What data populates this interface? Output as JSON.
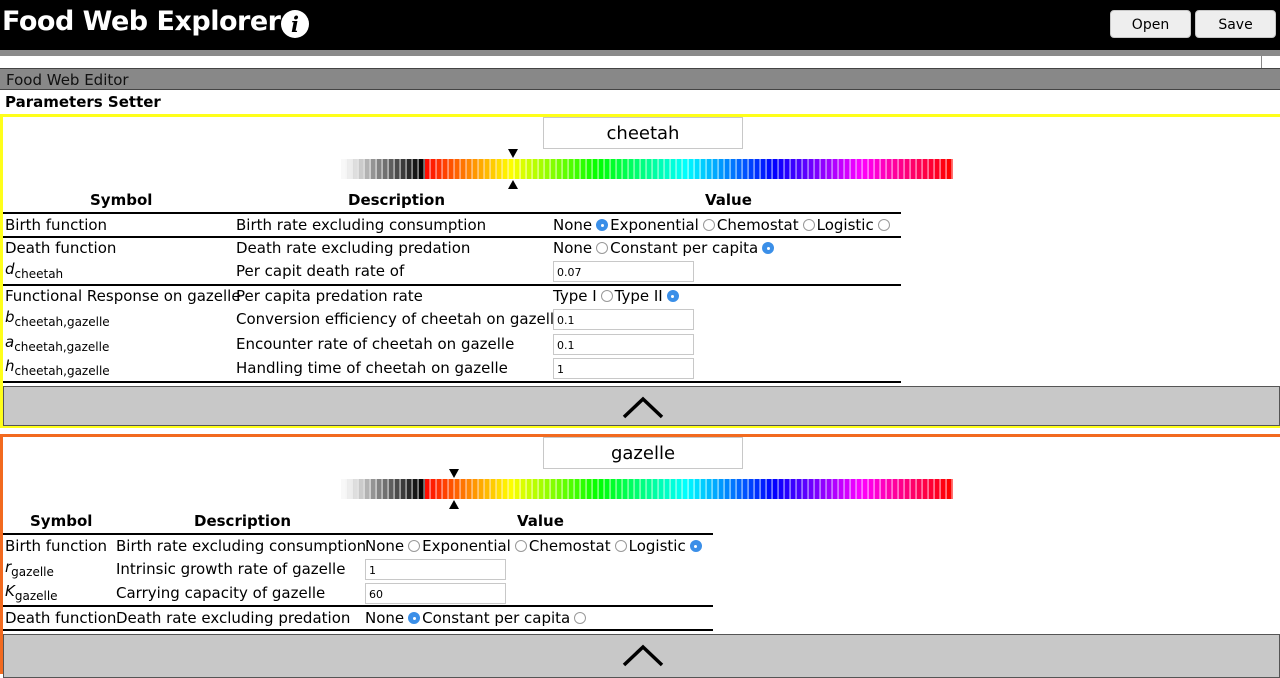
{
  "app": {
    "title": "Food Web Explorer",
    "info_icon": "info-icon"
  },
  "toolbar": {
    "open_label": "Open",
    "save_label": "Save"
  },
  "editor": {
    "header": "Food Web Editor",
    "params_title": "Parameters Setter"
  },
  "columns": {
    "symbol": "Symbol",
    "description": "Description",
    "value": "Value"
  },
  "spectrum_colors": [
    "#ffffff",
    "#808080",
    "#000000",
    "#ff0000",
    "#ffff00",
    "#00ff00",
    "#00ffff",
    "#0000ff",
    "#ff00ff",
    "#ff0000"
  ],
  "cheetah": {
    "name": "cheetah",
    "hue_marker": 0.29,
    "birth": {
      "symbol": "Birth function",
      "desc": "Birth rate excluding consumption",
      "options": [
        "None",
        "Exponential",
        "Chemostat",
        "Logistic"
      ],
      "selected": "None"
    },
    "death": {
      "symbol": "Death function",
      "desc": "Death rate excluding predation",
      "options": [
        "None",
        "Constant per capita"
      ],
      "selected": "Constant per capita"
    },
    "d": {
      "letter": "d",
      "sub": "cheetah",
      "desc": "Per capit death rate of",
      "value": "0.07"
    },
    "fr": {
      "symbol": "Functional Response on gazelle",
      "desc": "Per capita predation rate",
      "options": [
        "Type I",
        "Type II"
      ],
      "selected": "Type II"
    },
    "b": {
      "letter": "b",
      "sub": "cheetah,gazelle",
      "desc": "Conversion efficiency of cheetah on gazelle",
      "value": "0.1"
    },
    "a": {
      "letter": "a",
      "sub": "cheetah,gazelle",
      "desc": "Encounter rate of cheetah on gazelle",
      "value": "0.1"
    },
    "h": {
      "letter": "h",
      "sub": "cheetah,gazelle",
      "desc": "Handling time of cheetah on gazelle",
      "value": "1"
    }
  },
  "gazelle": {
    "name": "gazelle",
    "hue_marker": 0.19,
    "birth": {
      "symbol": "Birth function",
      "desc": "Birth rate excluding consumption",
      "options": [
        "None",
        "Exponential",
        "Chemostat",
        "Logistic"
      ],
      "selected": "Logistic"
    },
    "r": {
      "letter": "r",
      "sub": "gazelle",
      "desc": "Intrinsic growth rate of gazelle",
      "value": "1"
    },
    "K": {
      "letter": "K",
      "sub": "gazelle",
      "desc": "Carrying capacity of gazelle",
      "value": "60"
    },
    "death": {
      "symbol": "Death function",
      "desc": "Death rate excluding predation",
      "options": [
        "None",
        "Constant per capita"
      ],
      "selected": "None"
    }
  }
}
